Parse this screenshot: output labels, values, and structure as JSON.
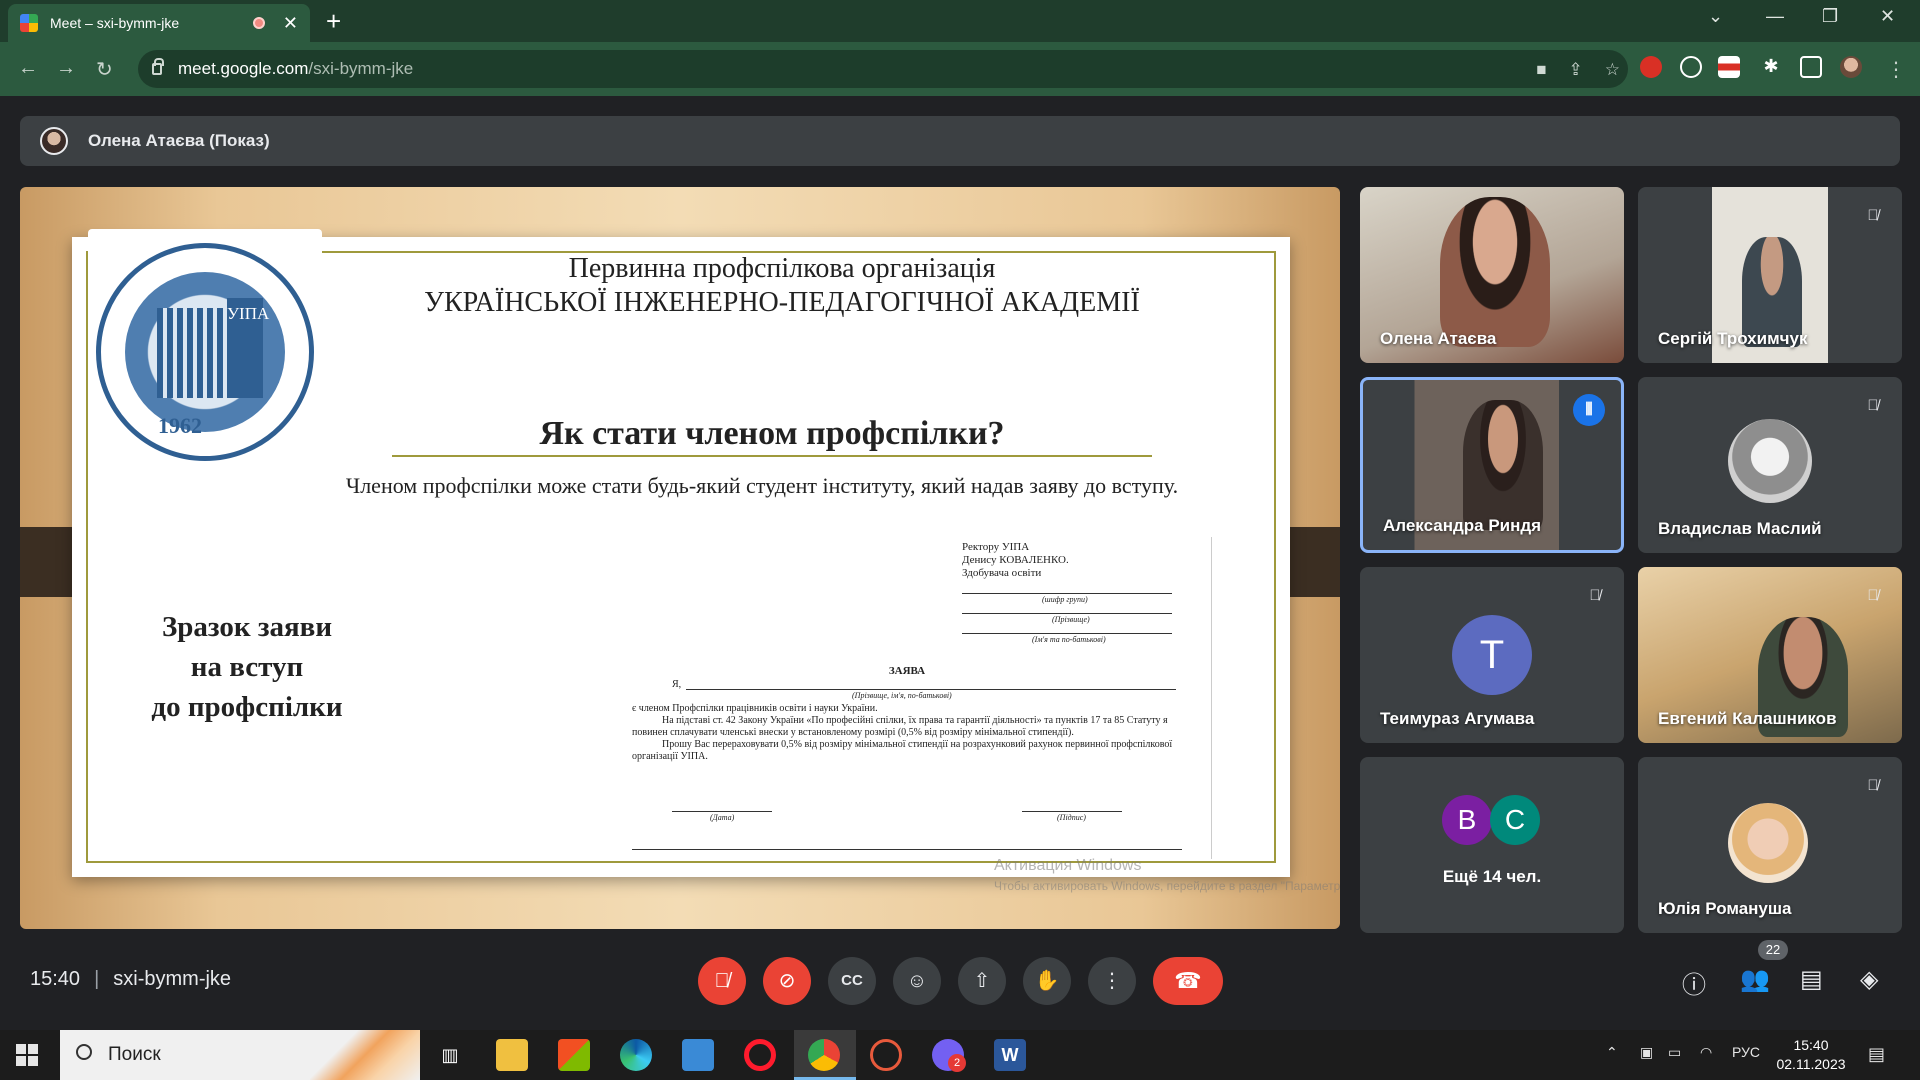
{
  "browser": {
    "tab_title": "Meet – sxi-bymm-jke",
    "url_host": "meet.google.com",
    "url_path": "/sxi-bymm-jke"
  },
  "meet": {
    "presenter_label": "Олена Атаєва (Показ)",
    "time": "15:40",
    "meeting_code": "sxi-bymm-jke",
    "people_count": "22"
  },
  "slide": {
    "org_line1": "Первинна профспілкова організація",
    "org_line2": "УКРАЇНСЬКОЇ ІНЖЕНЕРНО-ПЕДАГОГІЧНОЇ АКАДЕМІЇ",
    "logo_year": "1962",
    "logo_text": "УІПА",
    "question": "Як стати членом профспілки?",
    "member_text": "Членом профспілки може стати будь-який студент інституту, який надав заяву до вступу.",
    "sample_line1": "Зразок заяви",
    "sample_line2": "на вступ",
    "sample_line3": "до профспілки",
    "doc": {
      "addr1": "Ректору УІПА",
      "addr2": "Денису КОВАЛЕНКО.",
      "addr3": "Здобувача освіти",
      "cap_group": "(шифр групи)",
      "cap_surname": "(Прізвище)",
      "cap_name": "(Ім'я та по-батькові)",
      "title": "ЗАЯВА",
      "ya": "Я,",
      "cap_full": "(Прізвище, ім'я, по-батькові)",
      "p1": "є членом Профспілки працівників освіти і науки України.",
      "p2": "На підставі ст. 42 Закону України «По професійні спілки, їх права та гарантії діяльності» та пунктів 17 та 85 Статуту я повинен сплачувати членські внески у встановленому розмірі (0,5% від розміру мінімальної стипендії).",
      "p3": "Прошу Вас перераховувати 0,5% від розміру мінімальної стипендії на розрахунковий рахунок первинної профспілкової організації УІПА.",
      "cap_date": "(Дата)",
      "cap_sign": "(Підпис)"
    },
    "watermark1": "Активация Windows",
    "watermark2": "Чтобы активировать Windows, перейдите в раздел \"Параметры\"."
  },
  "participants": [
    {
      "name": "Олена Атаєва",
      "muted": false
    },
    {
      "name": "Сергій Трохимчук",
      "muted": true
    },
    {
      "name": "Александра Риндя",
      "muted": false,
      "speaking": true
    },
    {
      "name": "Владислав Маслий",
      "muted": true
    },
    {
      "name": "Теимураз Агумава",
      "muted": true,
      "initial": "T"
    },
    {
      "name": "Евгений Калашников",
      "muted": true
    },
    {
      "name": "Ещё 14 чел.",
      "initials": [
        "B",
        "C"
      ]
    },
    {
      "name": "Юлія Романуша",
      "muted": true
    }
  ],
  "taskbar": {
    "search_placeholder": "Поиск",
    "lang": "РУС",
    "time": "15:40",
    "date": "02.11.2023",
    "viber_badge": "2"
  },
  "colors": {
    "meet_bg": "#202124",
    "tile_bg": "#3c4043",
    "end_call": "#ea4335",
    "speaking_border": "#8ab4f8",
    "chrome_theme": "#2c5a3f"
  }
}
